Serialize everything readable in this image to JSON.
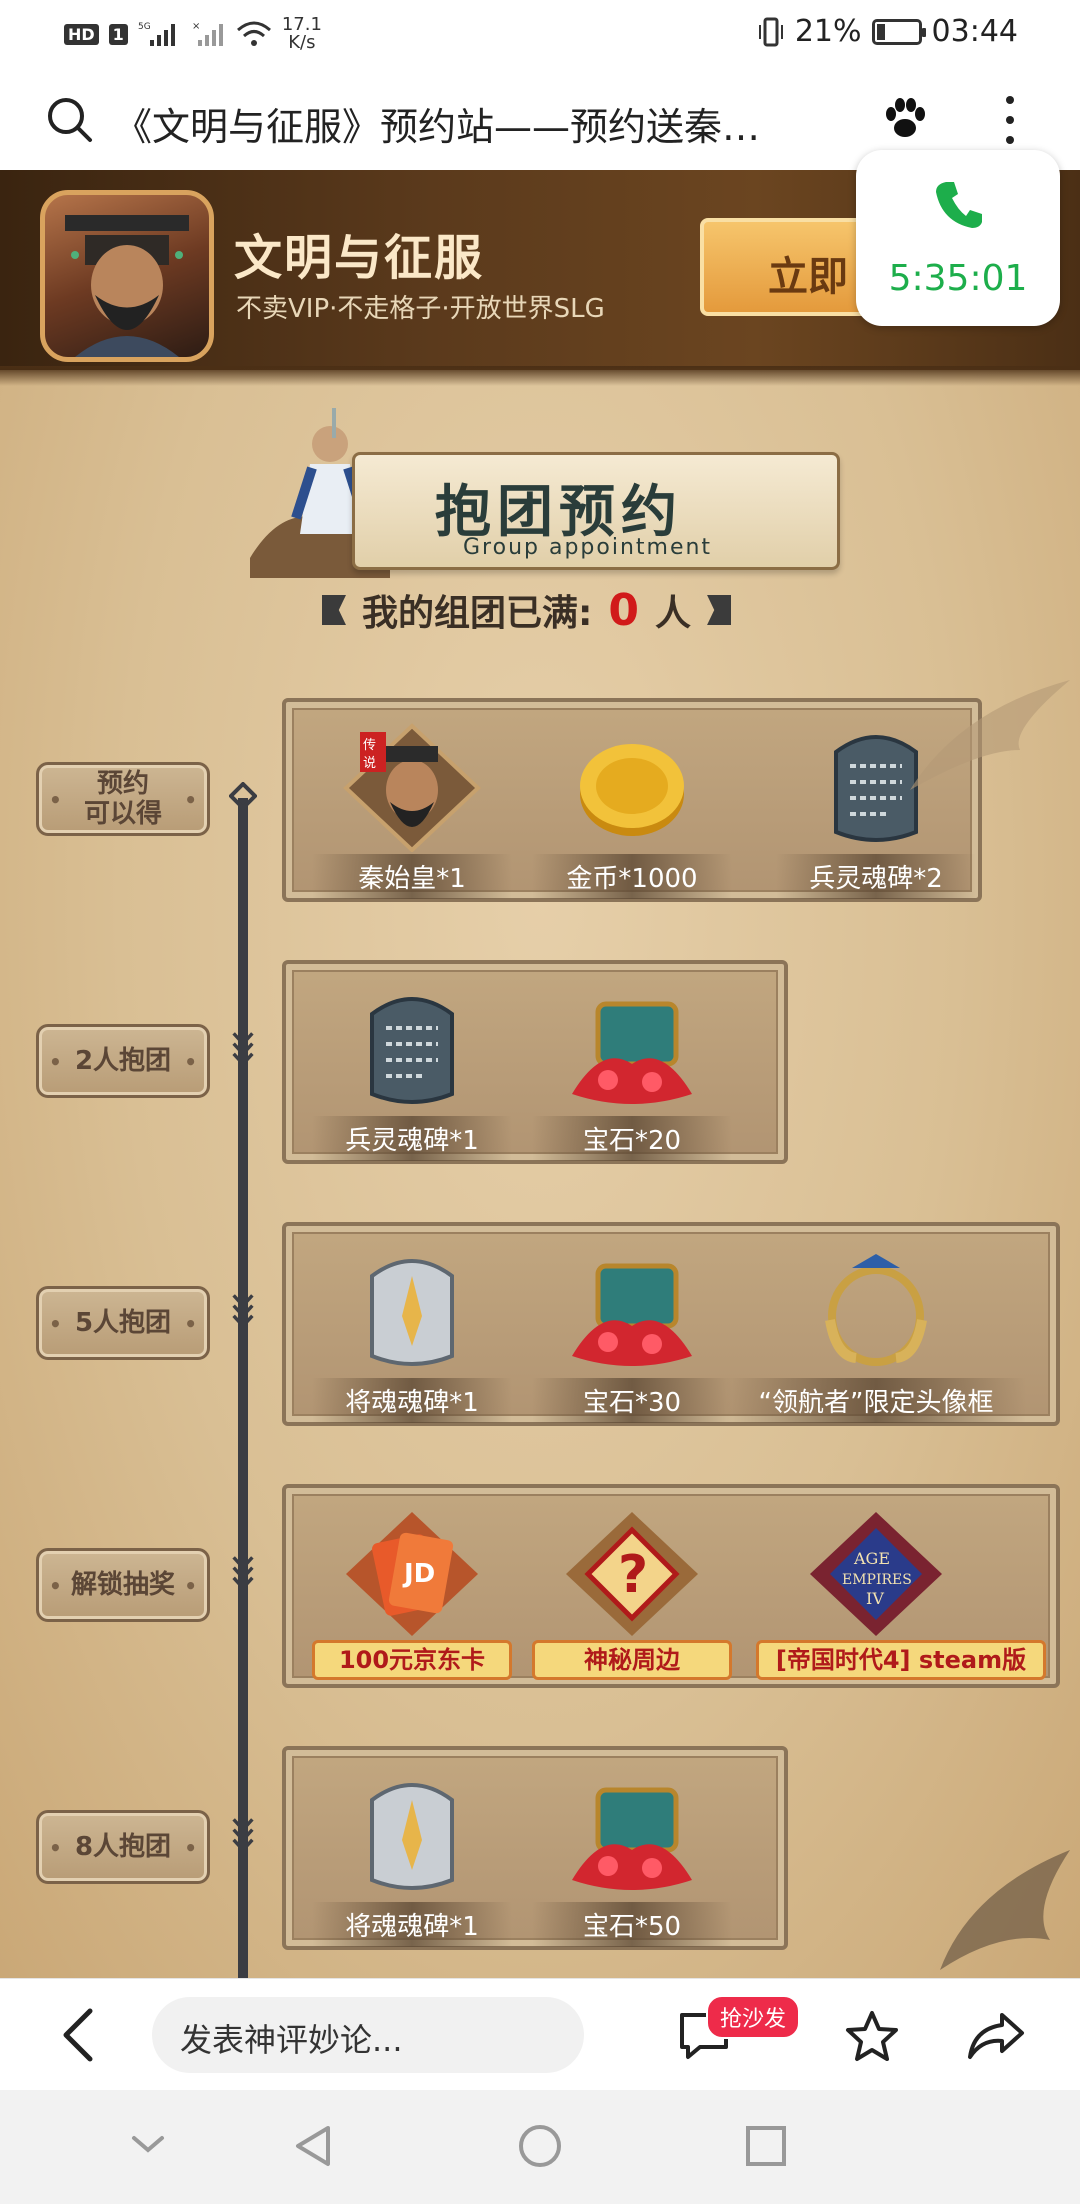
{
  "status_bar": {
    "badges": [
      "HD",
      "1"
    ],
    "network": "5G",
    "speed_value": "17.1",
    "speed_unit": "K/s",
    "battery_percent": "21%",
    "battery_level": 0.21,
    "time": "03:44"
  },
  "browser": {
    "page_title": "《文明与征服》预约站——预约送秦…"
  },
  "call_overlay": {
    "duration": "5:35:01",
    "accent": "#1dae4b"
  },
  "banner": {
    "app_name": "文明与征服",
    "slogan": "不卖VIP·不走格子·开放世界SLG",
    "cta_label": "立即"
  },
  "section": {
    "title": "抱团预约",
    "subtitle": "Group appointment",
    "team_prefix": "我的组团已满:",
    "team_count": "0",
    "team_suffix": "人"
  },
  "stages": [
    {
      "label": "预约\n可以得",
      "rewards": [
        {
          "label": "秦始皇*1",
          "icon": "hero-portrait-icon",
          "badge": "传说"
        },
        {
          "label": "金币*1000",
          "icon": "gold-coin-icon"
        },
        {
          "label": "兵灵魂碑*2",
          "icon": "stone-tablet-icon"
        }
      ]
    },
    {
      "label": "2人抱团",
      "rewards": [
        {
          "label": "兵灵魂碑*1",
          "icon": "stone-tablet-icon"
        },
        {
          "label": "宝石*20",
          "icon": "gem-chest-icon"
        }
      ]
    },
    {
      "label": "5人抱团",
      "rewards": [
        {
          "label": "将魂魂碑*1",
          "icon": "silver-tablet-icon"
        },
        {
          "label": "宝石*30",
          "icon": "gem-chest-icon"
        },
        {
          "label": "“领航者”限定头像框",
          "icon": "avatar-frame-icon"
        }
      ]
    },
    {
      "label": "解锁抽奖",
      "rewards": [
        {
          "label": "100元京东卡",
          "icon": "jd-card-icon"
        },
        {
          "label": "神秘周边",
          "icon": "mystery-question-icon"
        },
        {
          "label": "[帝国时代4] steam版",
          "icon": "age-of-empires-icon"
        }
      ]
    },
    {
      "label": "8人抱团",
      "rewards": [
        {
          "label": "将魂魂碑*1",
          "icon": "silver-tablet-icon"
        },
        {
          "label": "宝石*50",
          "icon": "gem-chest-icon"
        }
      ]
    }
  ],
  "comment_bar": {
    "input_placeholder": "发表神评妙论...",
    "sofa_badge": "抢沙发"
  }
}
